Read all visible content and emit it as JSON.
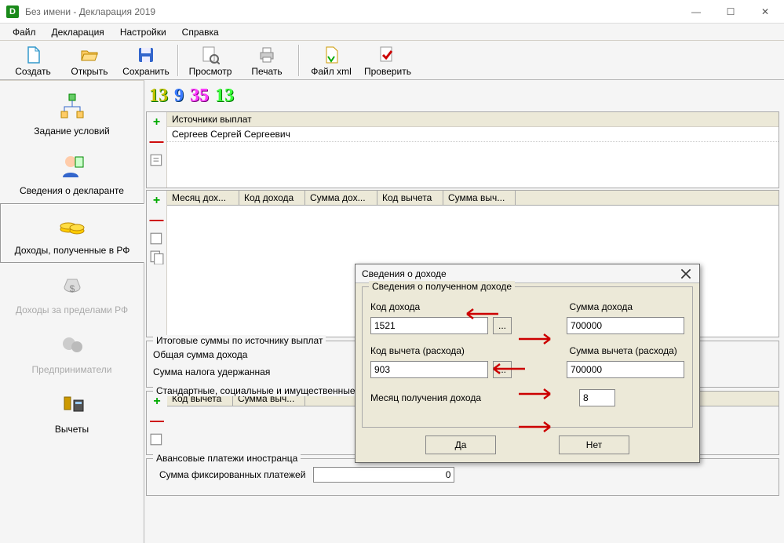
{
  "window": {
    "title": "Без имени - Декларация 2019"
  },
  "menu": {
    "file": "Файл",
    "declaration": "Декларация",
    "settings": "Настройки",
    "help": "Справка"
  },
  "toolbar": {
    "create": "Создать",
    "open": "Открыть",
    "save": "Сохранить",
    "preview": "Просмотр",
    "print": "Печать",
    "filexml": "Файл xml",
    "check": "Проверить"
  },
  "sidebar": {
    "conditions": "Задание условий",
    "declarant": "Сведения о декларанте",
    "income_rf": "Доходы, полученные в РФ",
    "income_abroad": "Доходы за пределами РФ",
    "entrepreneur": "Предприниматели",
    "deductions": "Вычеты"
  },
  "tabs": {
    "t1": "13",
    "t2": "9",
    "t3": "35",
    "t4": "13"
  },
  "sources": {
    "header": "Источники выплат",
    "row1": "Сергеев Сергей Сергеевич"
  },
  "income_headers": {
    "month": "Месяц дох...",
    "code": "Код дохода",
    "sum": "Сумма дох...",
    "dcode": "Код вычета",
    "dsum": "Сумма выч..."
  },
  "totals": {
    "legend": "Итоговые суммы по источнику выплат",
    "total_income": "Общая сумма дохода",
    "tax": "Сумма налога удержанная"
  },
  "std": {
    "legend": "Стандартные, социальные и имущественные вычеты",
    "dcode": "Код вычета",
    "dsum": "Сумма выч..."
  },
  "adv": {
    "legend": "Авансовые платежи иностранца",
    "label": "Сумма фиксированных платежей",
    "value": "0"
  },
  "dialog": {
    "title": "Сведения о доходе",
    "group_legend": "Сведения о полученном доходе",
    "code_label": "Код дохода",
    "sum_label": "Сумма дохода",
    "code_value": "1521",
    "sum_value": "700000",
    "dcode_label": "Код вычета (расхода)",
    "dsum_label": "Сумма вычета (расхода)",
    "dcode_value": "903",
    "dsum_value": "700000",
    "month_label": "Месяц получения дохода",
    "month_value": "8",
    "yes": "Да",
    "no": "Нет"
  }
}
